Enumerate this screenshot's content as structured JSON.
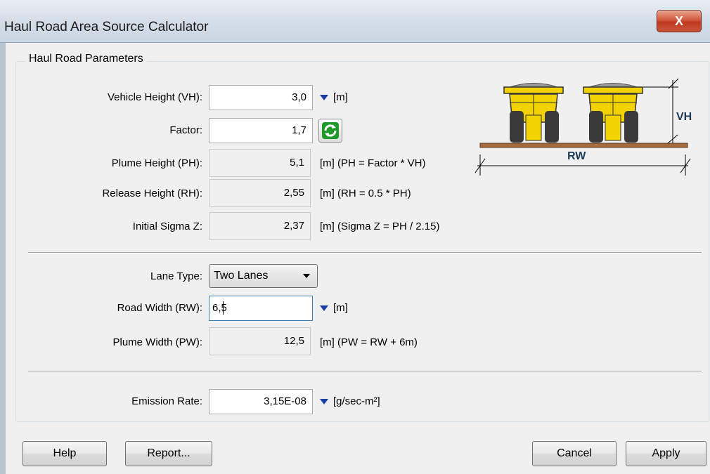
{
  "window": {
    "title": "Haul Road Area Source Calculator",
    "close_label": "X"
  },
  "group": {
    "legend": "Haul Road Parameters"
  },
  "fields": {
    "vehicle_height": {
      "label": "Vehicle Height (VH):",
      "value": "3,0",
      "unit": "[m]"
    },
    "factor": {
      "label": "Factor:",
      "value": "1,7"
    },
    "plume_height": {
      "label": "Plume Height (PH):",
      "value": "5,1",
      "unit": "[m] (PH = Factor * VH)"
    },
    "release_height": {
      "label": "Release Height (RH):",
      "value": "2,55",
      "unit": "[m] (RH = 0.5 * PH)"
    },
    "initial_sigma_z": {
      "label": "Initial Sigma Z:",
      "value": "2,37",
      "unit": "[m] (Sigma Z = PH / 2.15)"
    },
    "lane_type": {
      "label": "Lane Type:",
      "value": "Two Lanes"
    },
    "road_width": {
      "label": "Road Width (RW):",
      "value": "6,5",
      "unit": "[m]"
    },
    "plume_width": {
      "label": "Plume Width (PW):",
      "value": "12,5",
      "unit": "[m] (PW = RW + 6m)"
    },
    "emission_rate": {
      "label": "Emission Rate:",
      "value": "3,15E-08",
      "unit": "[g/sec-m²]"
    }
  },
  "diagram": {
    "vh_label": "VH",
    "rw_label": "RW"
  },
  "buttons": {
    "help": "Help",
    "report": "Report...",
    "cancel": "Cancel",
    "apply": "Apply"
  },
  "colors": {
    "truck_body": "#f2d200",
    "truck_tire": "#3a3a3a",
    "road": "#a56a3e",
    "load": "#9a9a9a",
    "dropdown_arrow": "#1a3fa8",
    "refresh_icon": "#1f9a2a"
  }
}
